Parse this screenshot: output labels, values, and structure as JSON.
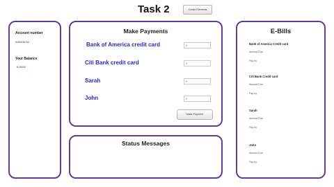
{
  "header": {
    "title": "Task 2",
    "create_button_label": "Create Elements"
  },
  "account": {
    "account_number_label": "Account number",
    "account_number_value": "8456938764",
    "balance_label": "Your Balance",
    "balance_value": "$ 25000"
  },
  "payments": {
    "title": "Make Payments",
    "rows": [
      {
        "label": "Bank of America credit card",
        "value": "0"
      },
      {
        "label": "Citi  Bank credit card",
        "value": "0"
      },
      {
        "label": "Sarah",
        "value": "0"
      },
      {
        "label": "John",
        "value": "0"
      }
    ],
    "submit_label": "Make Payment"
  },
  "status": {
    "title": "Status Messages"
  },
  "ebills": {
    "title": "E-Bills",
    "amount_due_label": "Amount Due",
    "pay_by_label": "Pay by",
    "items": [
      {
        "name": "Bank of America Credit card"
      },
      {
        "name": "Citi Bank Credit card"
      },
      {
        "name": "Sarah"
      },
      {
        "name": "John"
      }
    ]
  },
  "colors": {
    "panel_border": "#5b3f95",
    "payee_text": "#2a2ab8",
    "account_value_text": "#2233aa"
  }
}
